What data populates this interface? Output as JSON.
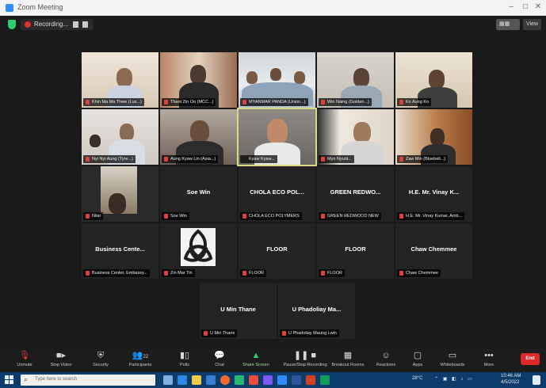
{
  "window": {
    "title": "Zoom Meeting"
  },
  "topbar": {
    "recording_label": "Recording...",
    "view_label": "View"
  },
  "tiles": [
    {
      "id": "t1",
      "name": "Khin Ma Ma Thwe (Lux...)",
      "muted": true
    },
    {
      "id": "t2",
      "name": "Thant Zin Oo (MCC...)",
      "muted": true
    },
    {
      "id": "t3",
      "name": "MYANMAR PANDA (Union...)",
      "muted": true
    },
    {
      "id": "t4",
      "name": "Win Naing (Golden...)",
      "muted": true
    },
    {
      "id": "t5",
      "name": "Ko Aung Ko",
      "muted": true
    },
    {
      "id": "t6",
      "name": "Nyi Nyi Aung (Tyre...)",
      "muted": true
    },
    {
      "id": "t7",
      "name": "Aung Kyaw Lin (Asia...)",
      "muted": true
    },
    {
      "id": "t8",
      "name": "Kyaw Kyaw...",
      "muted": false
    },
    {
      "id": "t9",
      "name": "Myo Nyunt...",
      "muted": true
    },
    {
      "id": "t10",
      "name": "Zaw Min (Bluebell...)",
      "muted": true
    },
    {
      "id": "t11",
      "name": "Nilar",
      "muted": true
    },
    {
      "id": "t12",
      "center": "Soe Win",
      "name": "Soe Win",
      "muted": true
    },
    {
      "id": "t13",
      "center": "CHOLA ECO POL...",
      "name": "CHOLA ECO POLYMERS",
      "muted": true
    },
    {
      "id": "t14",
      "center": "GREEN REDWO...",
      "name": "GREEN REDWOOD NEW",
      "muted": true
    },
    {
      "id": "t15",
      "center": "H.E. Mr. Vinay K...",
      "name": "H.E. Mr. Vinay Kumar, Amb...",
      "muted": true
    },
    {
      "id": "t16",
      "center": "Business Cente...",
      "name": "Business Center, Embassy...",
      "muted": true
    },
    {
      "id": "t17",
      "name": "Zin Mar Tin",
      "muted": true
    },
    {
      "id": "t18",
      "center": "FLOOR",
      "name": "FLOOR",
      "muted": true
    },
    {
      "id": "t19",
      "center": "FLOOR",
      "name": "FLOOR",
      "muted": true
    },
    {
      "id": "t20",
      "center": "Chaw Chemmee",
      "name": "Chaw Chemmee",
      "muted": true
    },
    {
      "id": "t21",
      "center": "U Min Thane",
      "name": "U Min Thane",
      "muted": true
    },
    {
      "id": "t22",
      "center": "U Phadoliay Ma...",
      "name": "U Phadoliay Maung Lwin",
      "muted": true
    }
  ],
  "toolbar": {
    "unmute": "Unmute",
    "stop_video": "Stop Video",
    "security": "Security",
    "participants": "Participants",
    "participants_count": "22",
    "polls": "Polls",
    "chat": "Chat",
    "share_screen": "Share Screen",
    "pause_recording": "Pause/Stop Recording",
    "breakout": "Breakout Rooms",
    "reactions": "Reactions",
    "apps": "Apps",
    "whiteboards": "Whiteboards",
    "more": "More",
    "end": "End"
  },
  "taskbar": {
    "search_placeholder": "Type here to search",
    "weather": "28°C",
    "time": "10:46 AM",
    "date": "4/5/2022"
  },
  "colors": {
    "accent_green": "#2ecc71",
    "end_red": "#e02828",
    "stage_bg": "#1a1a1a",
    "taskbar_bg": "#0b3c6a",
    "active_speaker": "#d9d98a"
  }
}
